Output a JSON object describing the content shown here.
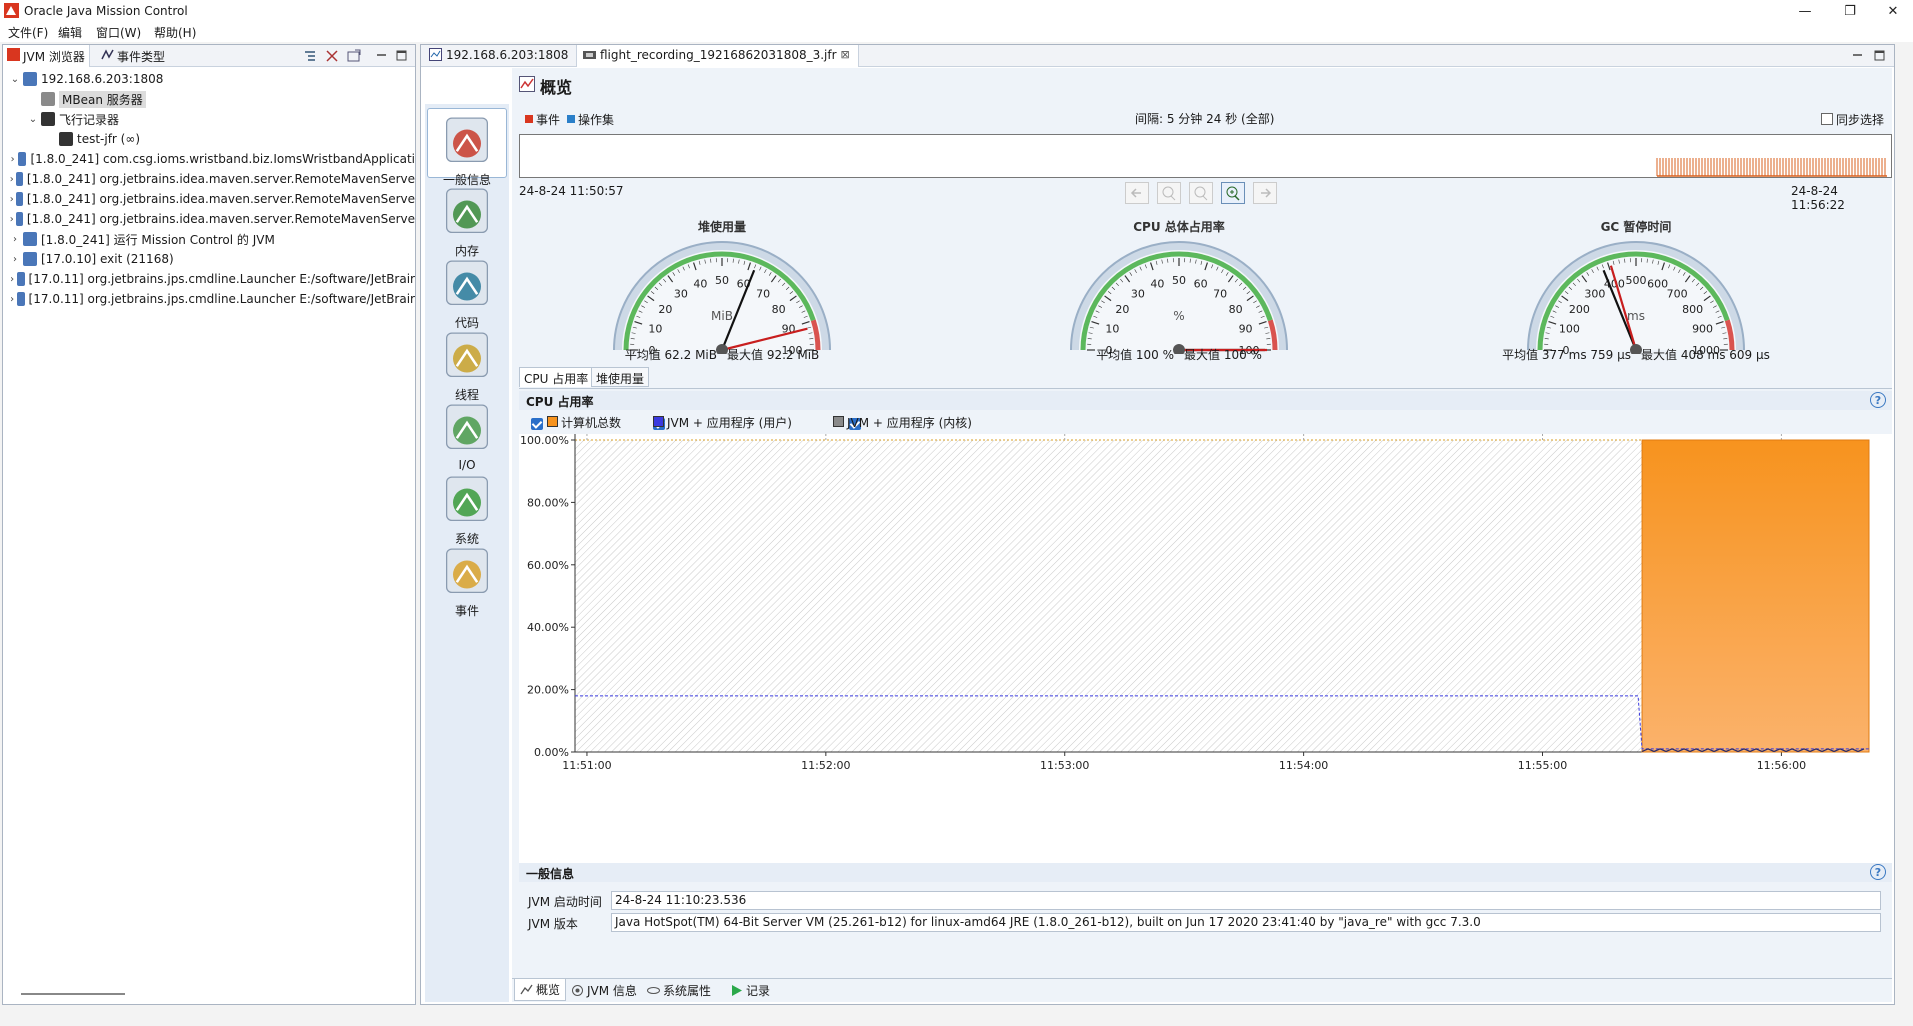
{
  "window": {
    "title": "Oracle Java Mission Control",
    "minimize": "—",
    "restore": "❐",
    "close": "✕"
  },
  "menu": [
    "文件(F)",
    "编辑",
    "窗口(W)",
    "帮助(H)"
  ],
  "left_tabs": [
    {
      "label": "JVM 浏览器"
    },
    {
      "label": "事件类型"
    }
  ],
  "tree": [
    {
      "label": "192.168.6.203:1808",
      "indent": 0,
      "twisty": "expanded"
    },
    {
      "label": "MBean 服务器",
      "indent": 1,
      "twisty": "none",
      "selected": true
    },
    {
      "label": "飞行记录器",
      "indent": 1,
      "twisty": "expanded"
    },
    {
      "label": "test-jfr (∞)",
      "indent": 2,
      "twisty": "none"
    },
    {
      "label": "[1.8.0_241] com.csg.ioms.wristband.biz.IomsWristbandApplicati",
      "indent": 0,
      "twisty": "collapsed"
    },
    {
      "label": "[1.8.0_241] org.jetbrains.idea.maven.server.RemoteMavenServe",
      "indent": 0,
      "twisty": "collapsed"
    },
    {
      "label": "[1.8.0_241] org.jetbrains.idea.maven.server.RemoteMavenServe",
      "indent": 0,
      "twisty": "collapsed"
    },
    {
      "label": "[1.8.0_241] org.jetbrains.idea.maven.server.RemoteMavenServe",
      "indent": 0,
      "twisty": "collapsed"
    },
    {
      "label": "[1.8.0_241] 运行 Mission Control 的 JVM",
      "indent": 0,
      "twisty": "collapsed"
    },
    {
      "label": "[17.0.10] exit (21168)",
      "indent": 0,
      "twisty": "collapsed"
    },
    {
      "label": "[17.0.11] org.jetbrains.jps.cmdline.Launcher E:/software/JetBrair",
      "indent": 0,
      "twisty": "collapsed"
    },
    {
      "label": "[17.0.11] org.jetbrains.jps.cmdline.Launcher E:/software/JetBrair",
      "indent": 0,
      "twisty": "collapsed"
    }
  ],
  "editor_tabs": [
    {
      "label": "192.168.6.203:1808"
    },
    {
      "label": "flight_recording_19216862031808_3.jfr",
      "close": "⊠"
    }
  ],
  "nav": [
    {
      "label": "一般信息",
      "icon": "gauge-icon",
      "selected": true
    },
    {
      "label": "内存",
      "icon": "memory-icon"
    },
    {
      "label": "代码",
      "icon": "code-icon"
    },
    {
      "label": "线程",
      "icon": "threads-icon"
    },
    {
      "label": "I/O",
      "icon": "io-icon"
    },
    {
      "label": "系统",
      "icon": "system-icon"
    },
    {
      "label": "事件",
      "icon": "events-icon"
    }
  ],
  "page_title": "概览",
  "timeline": {
    "legend_events": "事件",
    "legend_ops": "操作集",
    "interval": "间隔: 5 分钟 24 秒 (全部)",
    "sync_label": "同步选择",
    "start": "24-8-24 11:50:57",
    "end": "24-8-24 11:56:22"
  },
  "gauges": [
    {
      "title": "堆使用量",
      "unit": "MiB",
      "ticks": [
        "0",
        "10",
        "20",
        "30",
        "40",
        "50",
        "60",
        "70",
        "80",
        "90",
        "100"
      ],
      "needle_avg": 62.2,
      "needle_max": 92.2,
      "avg_label": "平均值 62.2 MiB",
      "max_label": "最大值 92.2 MiB"
    },
    {
      "title": "CPU 总体占用率",
      "unit": "%",
      "ticks": [
        "0",
        "10",
        "20",
        "30",
        "40",
        "50",
        "60",
        "70",
        "80",
        "90",
        "100"
      ],
      "needle_avg": 100,
      "needle_max": 100,
      "avg_label": "平均值 100 %",
      "max_label": "最大值 100 %"
    },
    {
      "title": "GC 暂停时间",
      "unit": "ms",
      "ticks": [
        "0",
        "100",
        "200",
        "300",
        "400",
        "500",
        "600",
        "700",
        "800",
        "900",
        "1000"
      ],
      "needle_avg": 377,
      "needle_max": 408,
      "avg_label": "平均值 377 ms 759 μs",
      "max_label": "最大值 408 ms 609 μs"
    }
  ],
  "sub_tabs": [
    {
      "label": "CPU 占用率"
    },
    {
      "label": "堆使用量"
    }
  ],
  "cpu_section_title": "CPU 占用率",
  "chart_data": {
    "type": "area",
    "title": "CPU 占用率",
    "legend": [
      "计算机总数",
      "JVM + 应用程序 (用户)",
      "JVM + 应用程序 (内核)"
    ],
    "legend_colors": [
      "#f7931e",
      "#3a3adf",
      "#8a8a8a"
    ],
    "ytick_labels": [
      "0.00%",
      "20.00%",
      "40.00%",
      "60.00%",
      "80.00%",
      "100.00%"
    ],
    "xtick_labels": [
      "11:51:00",
      "11:52:00",
      "11:53:00",
      "11:54:00",
      "11:55:00",
      "11:56:00"
    ],
    "ylim": [
      0,
      100
    ],
    "xlim": [
      "11:50:57",
      "11:56:22"
    ],
    "series": [
      {
        "name": "计算机总数",
        "x": [
          "11:55:24",
          "11:55:25",
          "11:56:22"
        ],
        "values": [
          null,
          100,
          100
        ]
      },
      {
        "name": "JVM + 应用程序 (用户)",
        "x": [
          "11:50:57",
          "11:55:24",
          "11:55:25",
          "11:56:22"
        ],
        "values": [
          18,
          18,
          1,
          1
        ]
      },
      {
        "name": "JVM + 应用程序 (内核)",
        "x": [
          "11:55:25",
          "11:56:22"
        ],
        "values": [
          0.5,
          0.5
        ]
      }
    ]
  },
  "general_info": {
    "title": "一般信息",
    "rows": [
      {
        "label": "JVM 启动时间",
        "value": "24-8-24 11:10:23.536"
      },
      {
        "label": "JVM 版本",
        "value": "Java HotSpot(TM) 64-Bit Server VM (25.261-b12) for linux-amd64 JRE (1.8.0_261-b12), built on Jun 17 2020 23:41:40 by \"java_re\" with gcc 7.3.0"
      }
    ]
  },
  "bottom_tabs": [
    {
      "label": "概览"
    },
    {
      "label": "JVM 信息"
    },
    {
      "label": "系统属性"
    },
    {
      "label": "记录"
    }
  ]
}
